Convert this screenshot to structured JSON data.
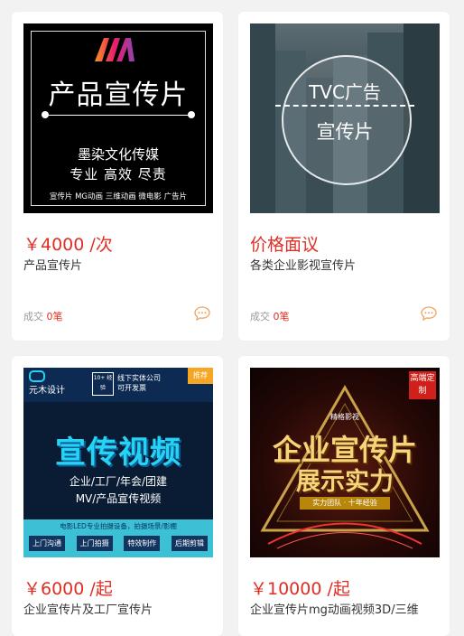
{
  "products": [
    {
      "price": "￥4000 /次",
      "title": "产品宣传片",
      "sales_label": "成交",
      "sales_count": "0笔",
      "thumb": {
        "headline": "产品宣传片",
        "company": "墨染文化传媒",
        "slogan": "专业  高效  尽责",
        "services": "宣传片  MG动画  三维动画  微电影  广告片"
      }
    },
    {
      "price": "价格面议",
      "title": "各类企业影视宣传片",
      "sales_label": "成交",
      "sales_count": "0笔",
      "thumb": {
        "line1": "TVC广告",
        "line2": "宣传片"
      }
    },
    {
      "price": "￥6000 /起",
      "title": "企业宣传片及工厂宣传片",
      "thumb": {
        "brand": "元木设计",
        "years": "10+ 经验",
        "office": "线下实体公司",
        "invoice": "可开发票",
        "tag": "推荐",
        "headline": "宣传视频",
        "line1": "企业/工厂/年会/团建",
        "line2": "MV/产品宣传视频",
        "note": "电影LED专业拍摄设备，拍摄场景/影棚",
        "buttons": [
          "上门沟通",
          "上门拍摄",
          "特效制作",
          "后期剪辑"
        ]
      }
    },
    {
      "price": "￥10000 /起",
      "title": "企业宣传片mg动画视频3D/三维",
      "thumb": {
        "badge": "高端定制",
        "sub": "精格影视",
        "headline1": "企业宣传片",
        "headline2": "展示实力",
        "ribbon": "实力团队 · 十年经验"
      }
    }
  ],
  "icons": {
    "chat": "chat-bubble-icon"
  },
  "colors": {
    "price": "#e02e24",
    "sales_count": "#e02e24",
    "chat_icon": "#f0a35e"
  }
}
